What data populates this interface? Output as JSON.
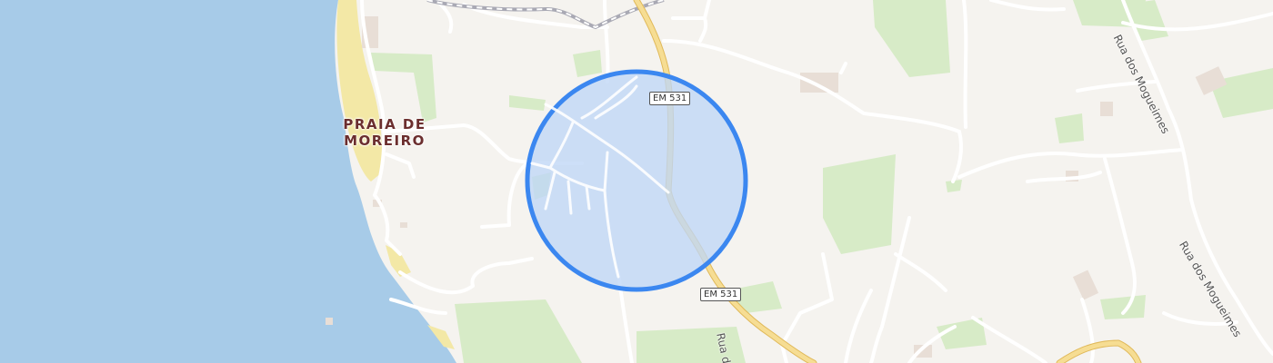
{
  "map": {
    "place_label_line1": "PRAIA DE",
    "place_label_line2": "MOREIRO",
    "route_shield_top": "EM 531",
    "route_shield_bottom": "EM 531",
    "street_right_upper": "Rua dos Mogueimes",
    "street_right_lower": "Rua dos Mogueimes",
    "street_bottom": "Rua do",
    "colors": {
      "sea": "#a7cbe8",
      "land": "#f5f3ef",
      "beach": "#f3e8a6",
      "vegetation": "#d7ebc7",
      "main_road": "#f3d98c",
      "location_circle_fill": "#bfd6f6",
      "location_circle_stroke": "#3b87f0"
    }
  }
}
